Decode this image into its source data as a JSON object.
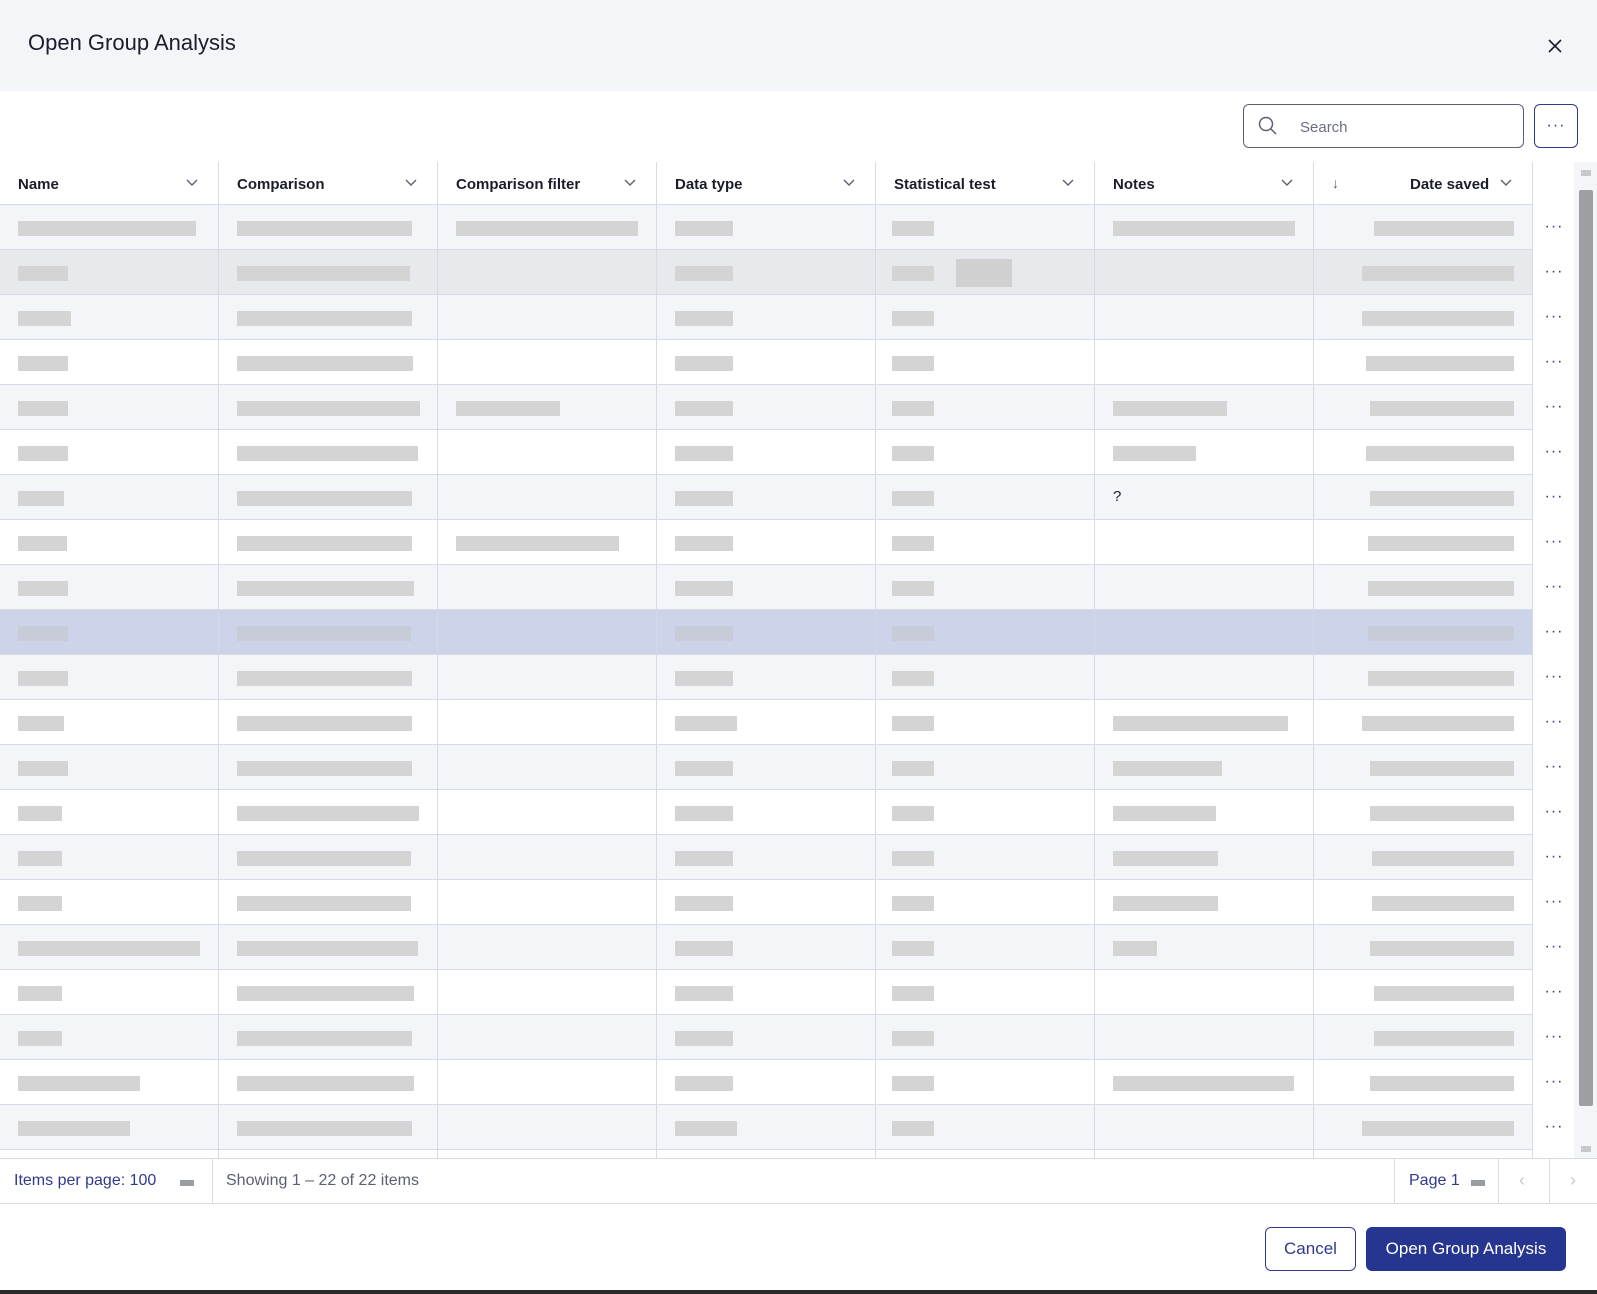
{
  "dialog": {
    "title": "Open Group Analysis",
    "close_icon": "close-icon"
  },
  "toolbar": {
    "search_placeholder": "Search",
    "search_value": "",
    "more_label": "···"
  },
  "table": {
    "columns": [
      {
        "label": "Name",
        "sortable": true
      },
      {
        "label": "Comparison",
        "sortable": true
      },
      {
        "label": "Comparison filter",
        "sortable": true
      },
      {
        "label": "Data type",
        "sortable": true
      },
      {
        "label": "Statistical test",
        "sortable": true
      },
      {
        "label": "Notes",
        "sortable": true
      },
      {
        "label": "Date saved",
        "sortable": true,
        "sort_direction": "descending"
      }
    ],
    "row_menu_label": "···",
    "visible_notes_text": "?",
    "selected_row_index": 9,
    "hovered_row_index": 1,
    "row_count_visible": 21
  },
  "pagination": {
    "items_per_page": "Items per page: 100",
    "showing": "Showing 1 – 22 of 22 items",
    "page": "Page 1"
  },
  "footer": {
    "cancel_label": "Cancel",
    "primary_label": "Open Group Analysis"
  },
  "colors": {
    "accent": "#263690",
    "header_bg": "#f4f5f8",
    "selected_row": "#cdd3e8",
    "placeholder_bar": "#d4d4d4"
  }
}
